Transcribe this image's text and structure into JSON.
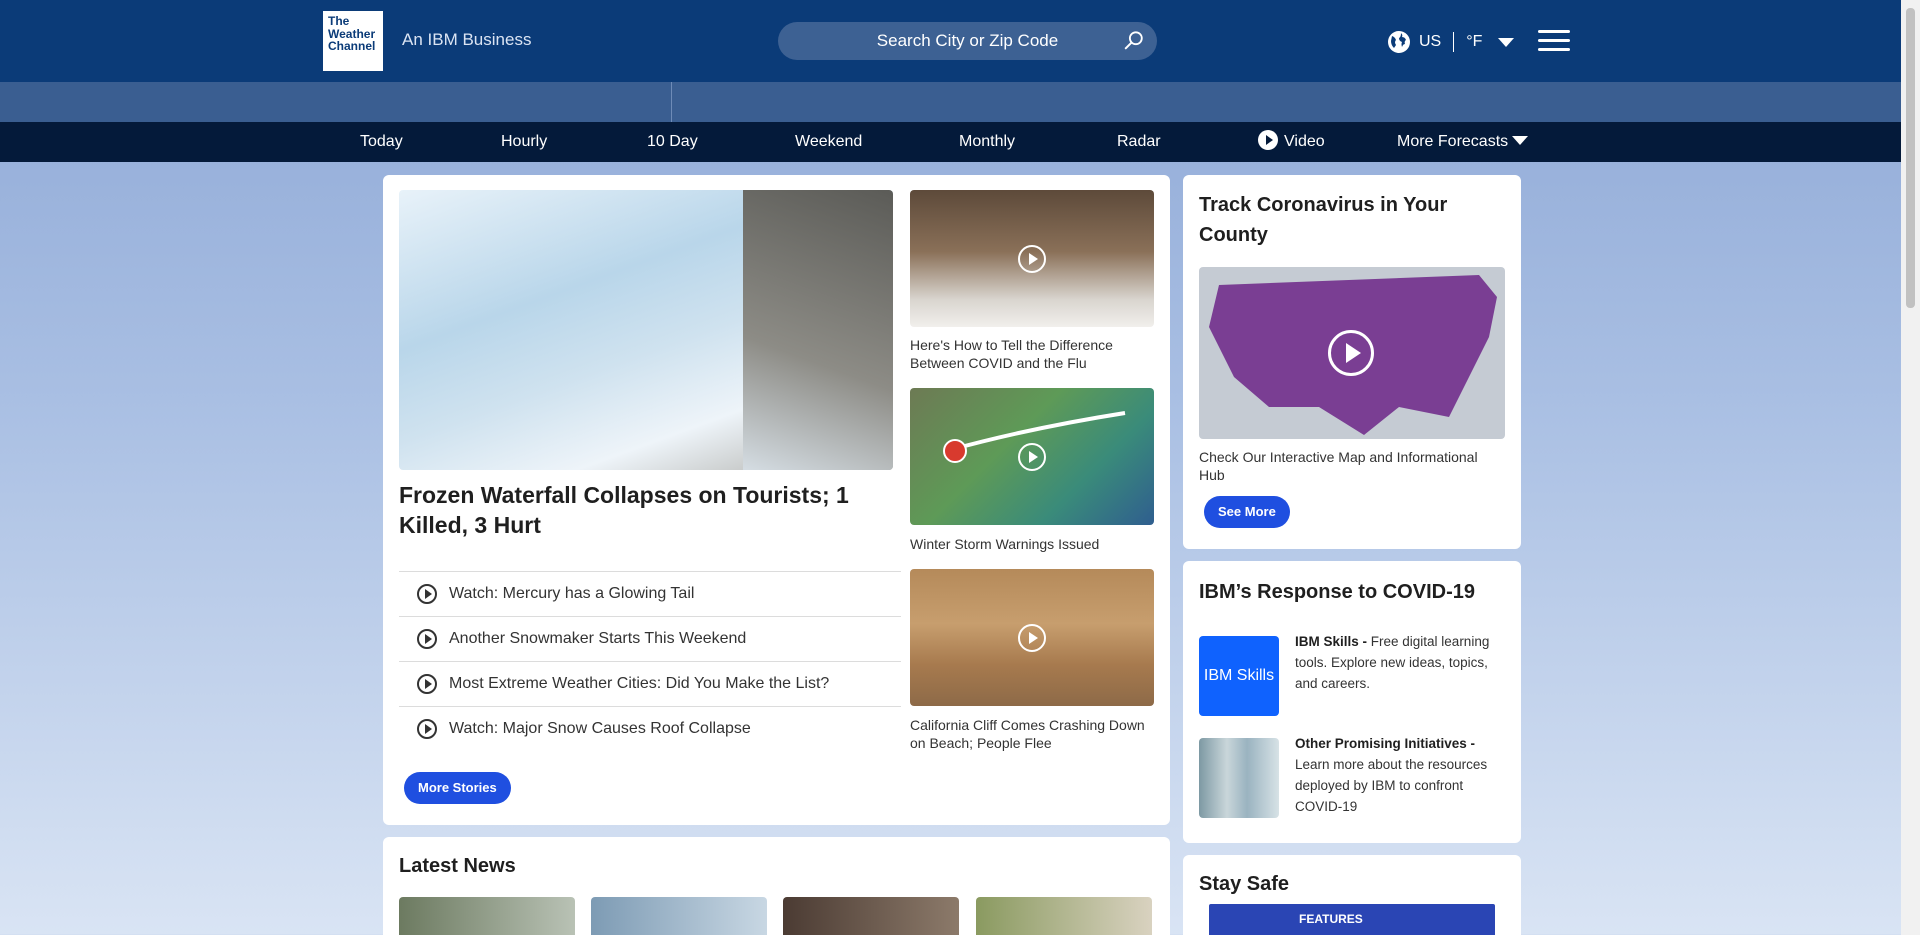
{
  "header": {
    "logo_lines": [
      "The",
      "Weather",
      "Channel"
    ],
    "tagline": "An IBM Business",
    "search_placeholder": "Search City or Zip Code",
    "locale_country": "US",
    "locale_unit": "°F"
  },
  "nav": {
    "items": [
      "Today",
      "Hourly",
      "10 Day",
      "Weekend",
      "Monthly",
      "Radar",
      "Video",
      "More Forecasts"
    ]
  },
  "main": {
    "hero_title": "Frozen Waterfall Collapses on Tourists; 1 Killed, 3 Hurt",
    "stories": [
      "Watch: Mercury has a Glowing Tail",
      "Another Snowmaker Starts This Weekend",
      "Most Extreme Weather Cities: Did You Make the List?",
      "Watch: Major Snow Causes Roof Collapse"
    ],
    "more_stories_label": "More Stories",
    "videos": [
      "Here's How to Tell the Difference Between COVID and the Flu",
      "Winter Storm Warnings Issued",
      "California Cliff Comes Crashing Down on Beach; People Flee"
    ]
  },
  "covid_card": {
    "title": "Track Coronavirus in Your County",
    "caption": "Check Our Interactive Map and Informational Hub",
    "button": "See More"
  },
  "ibm_card": {
    "title": "IBM’s Response to COVID-19",
    "skills_tile": "IBM Skills",
    "skills_name": "IBM Skills -",
    "skills_text": " Free digital learning tools. Explore new ideas, topics, and careers.",
    "initiatives_name": "Other Promising Initiatives -",
    "initiatives_text": " Learn more about the resources deployed by IBM to confront COVID-19"
  },
  "latest_news": {
    "title": "Latest News"
  },
  "stay_safe": {
    "title": "Stay Safe",
    "features_label": "FEATURES"
  },
  "colors": {
    "header": "#0b3b78",
    "nav": "#041a3a",
    "accent_button": "#1f4fe0",
    "ibm_blue": "#0f62fe"
  }
}
